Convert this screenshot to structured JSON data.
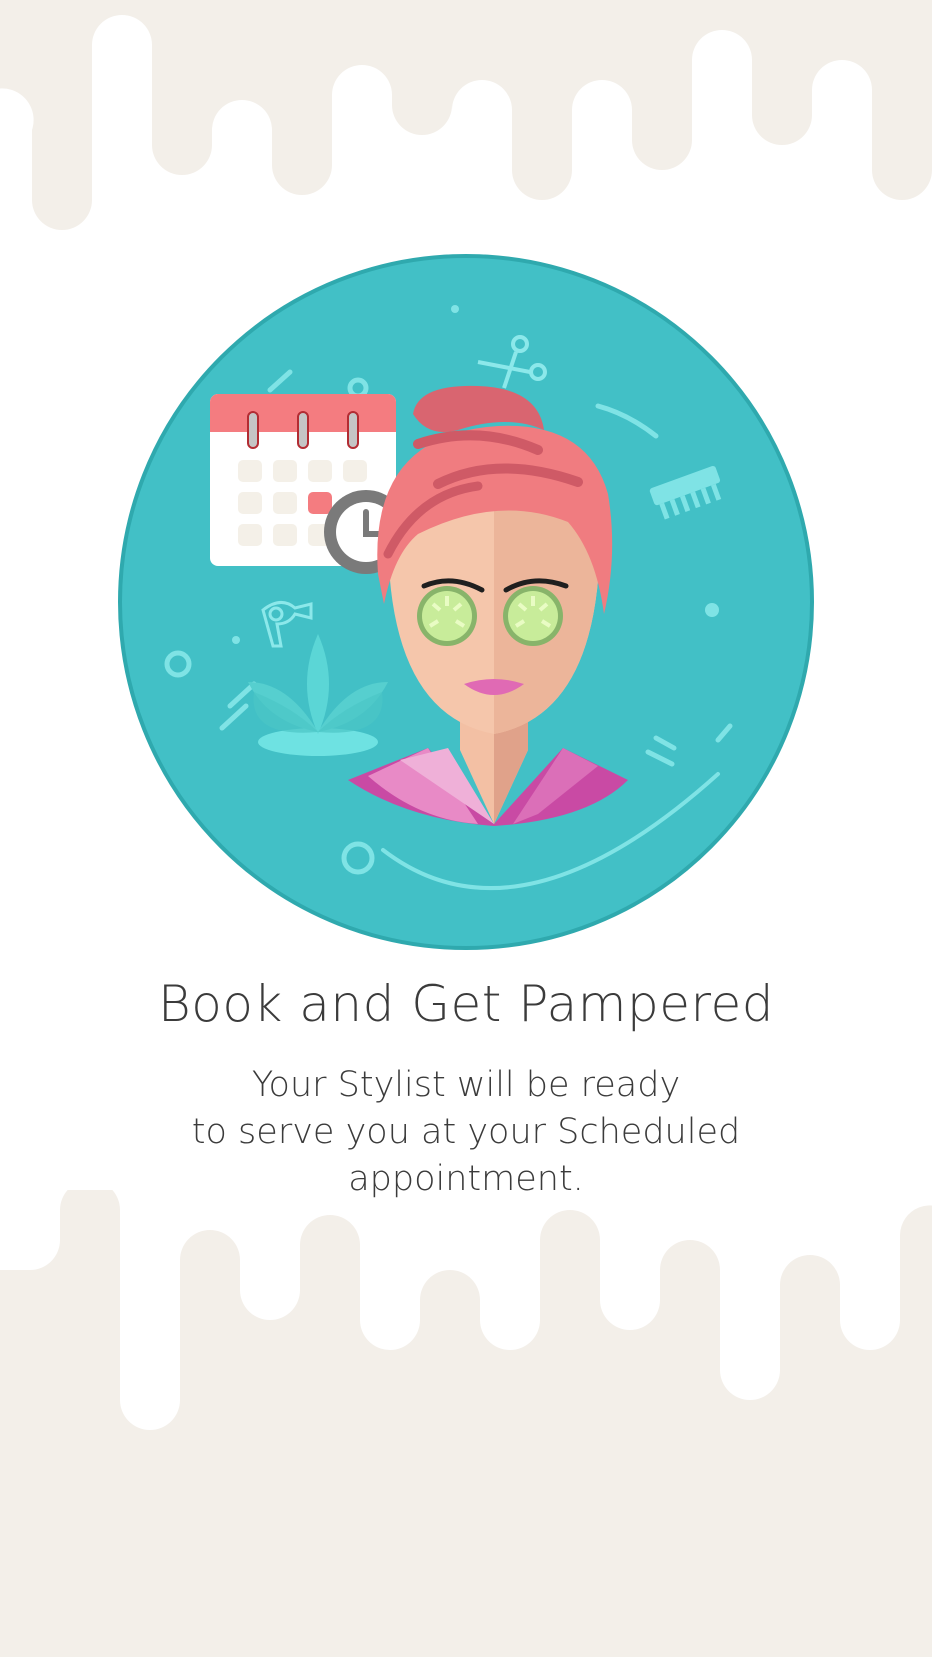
{
  "onboarding": {
    "title": "Book and Get Pampered",
    "description_lines": [
      "Your Stylist will be ready",
      "to serve you at your Scheduled",
      "appointment."
    ]
  },
  "illustration": {
    "subject": "woman-with-cucumber-eye-mask",
    "icons": [
      "calendar-icon",
      "clock-icon",
      "scissors-icon",
      "comb-icon",
      "hair-dryer-icon",
      "lotus-icon"
    ]
  },
  "colors": {
    "background": "#ffffff",
    "drip": "#f3efe9",
    "hero_circle": "#42c0c6",
    "hero_circle_border": "#2fa9ae",
    "hair": "#f07c80",
    "text": "#3b3b3b"
  }
}
